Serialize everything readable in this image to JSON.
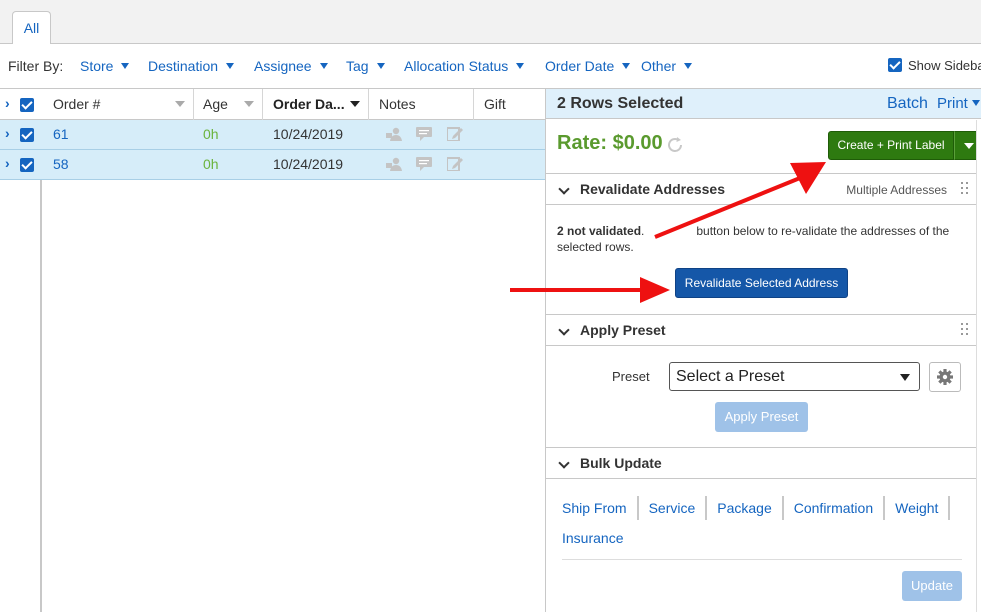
{
  "tabs": [
    {
      "label": "All"
    }
  ],
  "filters": {
    "label": "Filter By:",
    "items": [
      "Store",
      "Destination",
      "Assignee",
      "Tag",
      "Allocation Status",
      "Order Date",
      "Other"
    ],
    "show_sidebar": "Show Sidebar"
  },
  "grid": {
    "columns": [
      "Order #",
      "Age",
      "Order Da...",
      "Notes",
      "Gift"
    ],
    "rows": [
      {
        "order": "61",
        "age": "0h",
        "date": "10/24/2019"
      },
      {
        "order": "58",
        "age": "0h",
        "date": "10/24/2019"
      }
    ]
  },
  "sidebar": {
    "title": "2 Rows Selected",
    "batch": "Batch",
    "print": "Print",
    "rate": "Rate: $0.00",
    "create_label": "Create + Print Label",
    "revalidate": {
      "title": "Revalidate Addresses",
      "multiple": "Multiple Addresses",
      "not_validated": "2 not validated",
      "text_a": ".",
      "text_b": "button below to re-validate the addresses of the selected rows.",
      "button": "Revalidate Selected Address"
    },
    "preset": {
      "title": "Apply Preset",
      "label": "Preset",
      "select_value": "Select a Preset",
      "apply": "Apply Preset"
    },
    "bulk": {
      "title": "Bulk Update",
      "links": [
        "Ship From",
        "Service",
        "Package",
        "Confirmation",
        "Weight",
        "Insurance"
      ],
      "update": "Update"
    }
  },
  "colors": {
    "accent": "#1565c0",
    "green_button": "#2e7a10",
    "rate_green": "#5a9a2e",
    "row_selected": "#d6edf9",
    "annotation_arrow": "#ee1111"
  }
}
